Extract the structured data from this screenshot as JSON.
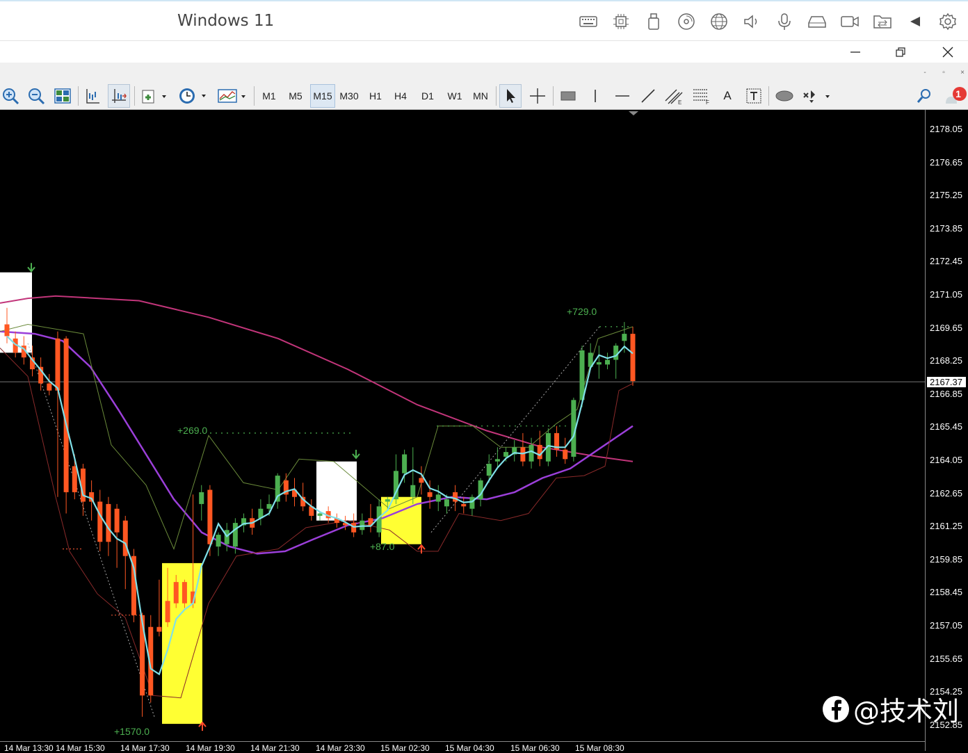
{
  "vm_bar": {
    "title": "Windows 11",
    "icons": [
      "keyboard-icon",
      "cpu-icon",
      "usb-icon",
      "disc-icon",
      "globe-icon",
      "speaker-icon",
      "microphone-icon",
      "drive-icon",
      "camera-icon",
      "shared-folder-icon",
      "back-icon",
      "settings-icon"
    ]
  },
  "window_controls": {
    "minimize": "—",
    "restore": "❐",
    "close": "✕"
  },
  "mdi_controls": {
    "minimize": "-",
    "restore": "▫",
    "close": "×"
  },
  "toolbar": {
    "timeframes": [
      "M1",
      "M5",
      "M15",
      "M30",
      "H1",
      "H4",
      "D1",
      "W1",
      "MN"
    ],
    "active_timeframe": "M15",
    "text_tool": "A",
    "notification_count": "1"
  },
  "price_axis": {
    "labels": [
      "2178.05",
      "2176.65",
      "2175.25",
      "2173.85",
      "2172.45",
      "2171.05",
      "2169.65",
      "2168.25",
      "2166.85",
      "2165.45",
      "2164.05",
      "2162.65",
      "2161.25",
      "2159.85",
      "2158.45",
      "2157.05",
      "2155.65",
      "2154.25",
      "2152.85"
    ],
    "current_price": "2167.37"
  },
  "time_axis": {
    "labels": [
      "14 Mar 13:30",
      "14 Mar 15:30",
      "14 Mar 17:30",
      "14 Mar 19:30",
      "14 Mar 21:30",
      "14 Mar 23:30",
      "15 Mar 02:30",
      "15 Mar 04:30",
      "15 Mar 06:30",
      "15 Mar 08:30"
    ]
  },
  "annotations": {
    "a1": "+269.0",
    "a2": "+87.0",
    "a3": "+729.0",
    "a4": "+1570.0"
  },
  "watermark": {
    "text": "@技术刘"
  },
  "chart_data": {
    "type": "candlestick",
    "ylim": [
      2152.4,
      2178.5
    ],
    "colors": {
      "up": "#4caf50",
      "down": "#ff5722",
      "fast_ma": "#7fe0e8",
      "mid_ma": "#9b3fd9",
      "slow_ma": "#c2357a",
      "box_white": "#ffffff",
      "box_yellow": "#ffff33"
    },
    "candles": [
      [
        2169.8,
        2170.5,
        2169.3,
        2169.0
      ],
      [
        2169.2,
        2169.5,
        2168.6,
        2168.4
      ],
      [
        2168.9,
        2169.3,
        2168.4,
        2168.1
      ],
      [
        2168.4,
        2168.9,
        2167.9,
        2167.6
      ],
      [
        2168.0,
        2168.4,
        2167.3,
        2167.0
      ],
      [
        2167.3,
        2167.7,
        2167.0,
        2166.8
      ],
      [
        2169.2,
        2169.5,
        2167.0,
        2162.5
      ],
      [
        2169.2,
        2169.3,
        2162.7,
        2161.8
      ],
      [
        2163.8,
        2164.3,
        2162.7,
        2162.4
      ],
      [
        2163.7,
        2163.9,
        2162.3,
        2161.7
      ],
      [
        2162.7,
        2163.2,
        2162.3,
        2161.5
      ],
      [
        2162.3,
        2162.8,
        2160.6,
        2160.2
      ],
      [
        2162.2,
        2162.5,
        2160.6,
        2160.0
      ],
      [
        2162.0,
        2162.2,
        2161.0,
        2159.5
      ],
      [
        2161.5,
        2161.7,
        2160.0,
        2158.6
      ],
      [
        2160.0,
        2160.3,
        2157.5,
        2157.2
      ],
      [
        2157.5,
        2157.6,
        2154.1,
        2153.2
      ],
      [
        2157.0,
        2157.5,
        2154.1,
        2153.8
      ],
      [
        2157.0,
        2159.0,
        2156.8,
        2156.6
      ],
      [
        2158.1,
        2159.5,
        2157.2,
        2157.0
      ],
      [
        2158.9,
        2159.2,
        2158.0,
        2157.8
      ],
      [
        2158.9,
        2159.0,
        2158.0,
        2157.8
      ],
      [
        2158.5,
        2162.6,
        2158.0,
        2157.8
      ],
      [
        2162.2,
        2163.0,
        2162.7,
        2161.5
      ],
      [
        2162.8,
        2163.0,
        2160.5,
        2160.0
      ],
      [
        2160.4,
        2161.0,
        2160.9,
        2160.0
      ],
      [
        2160.5,
        2161.4,
        2161.1,
        2160.2
      ],
      [
        2160.4,
        2161.6,
        2161.4,
        2160.1
      ],
      [
        2161.3,
        2161.8,
        2161.6,
        2161.0
      ],
      [
        2161.6,
        2162.0,
        2161.2,
        2160.9
      ],
      [
        2161.6,
        2162.4,
        2162.0,
        2161.3
      ],
      [
        2162.0,
        2162.6,
        2162.2,
        2161.7
      ],
      [
        2162.3,
        2163.5,
        2163.4,
        2162.0
      ],
      [
        2163.2,
        2163.5,
        2162.6,
        2162.3
      ],
      [
        2162.8,
        2163.3,
        2162.5,
        2162.1
      ],
      [
        2162.5,
        2163.1,
        2162.1,
        2161.9
      ],
      [
        2162.1,
        2162.4,
        2161.7,
        2161.5
      ],
      [
        2161.7,
        2161.9,
        2161.8,
        2161.5
      ],
      [
        2161.9,
        2162.1,
        2161.6,
        2161.4
      ],
      [
        2161.6,
        2161.8,
        2161.4,
        2161.2
      ],
      [
        2161.4,
        2161.7,
        2161.3,
        2161.1
      ],
      [
        2161.4,
        2161.8,
        2161.0,
        2160.8
      ],
      [
        2161.1,
        2161.8,
        2161.5,
        2160.9
      ],
      [
        2161.6,
        2162.2,
        2161.3,
        2161.0
      ],
      [
        2161.0,
        2162.4,
        2162.1,
        2160.8
      ],
      [
        2162.3,
        2162.5,
        2162.4,
        2161.9
      ],
      [
        2162.4,
        2164.3,
        2163.6,
        2162.2
      ],
      [
        2163.5,
        2164.5,
        2164.3,
        2163.1
      ],
      [
        2162.5,
        2164.6,
        2163.0,
        2162.2
      ],
      [
        2163.3,
        2163.8,
        2163.1,
        2162.6
      ],
      [
        2162.7,
        2163.2,
        2162.5,
        2162.0
      ],
      [
        2162.3,
        2163.0,
        2162.6,
        2161.9
      ],
      [
        2162.1,
        2162.6,
        2162.4,
        2161.8
      ],
      [
        2162.7,
        2163.0,
        2162.3,
        2161.9
      ],
      [
        2162.2,
        2162.5,
        2162.1,
        2161.8
      ],
      [
        2162.0,
        2162.6,
        2162.5,
        2161.7
      ],
      [
        2162.4,
        2163.3,
        2163.2,
        2162.1
      ],
      [
        2163.4,
        2164.3,
        2163.9,
        2163.1
      ],
      [
        2164.0,
        2164.6,
        2164.1,
        2163.7
      ],
      [
        2164.2,
        2164.6,
        2164.4,
        2164.0
      ],
      [
        2164.3,
        2164.9,
        2164.6,
        2164.0
      ],
      [
        2164.6,
        2165.2,
        2164.0,
        2163.8
      ],
      [
        2164.0,
        2165.0,
        2164.7,
        2163.7
      ],
      [
        2164.7,
        2165.3,
        2164.1,
        2163.8
      ],
      [
        2164.0,
        2165.4,
        2165.2,
        2163.8
      ],
      [
        2165.2,
        2165.5,
        2164.5,
        2164.2
      ],
      [
        2164.5,
        2165.0,
        2164.1,
        2163.9
      ],
      [
        2164.2,
        2166.7,
        2166.6,
        2164.0
      ],
      [
        2166.6,
        2168.9,
        2168.7,
        2166.3
      ],
      [
        2168.0,
        2169.0,
        2168.6,
        2167.9
      ],
      [
        2168.1,
        2168.9,
        2168.2,
        2167.5
      ],
      [
        2168.1,
        2168.6,
        2168.3,
        2167.9
      ],
      [
        2168.3,
        2169.0,
        2168.9,
        2167.5
      ],
      [
        2169.1,
        2169.9,
        2169.4,
        2168.6
      ],
      [
        2169.4,
        2169.7,
        2167.4,
        2167.2
      ]
    ]
  }
}
